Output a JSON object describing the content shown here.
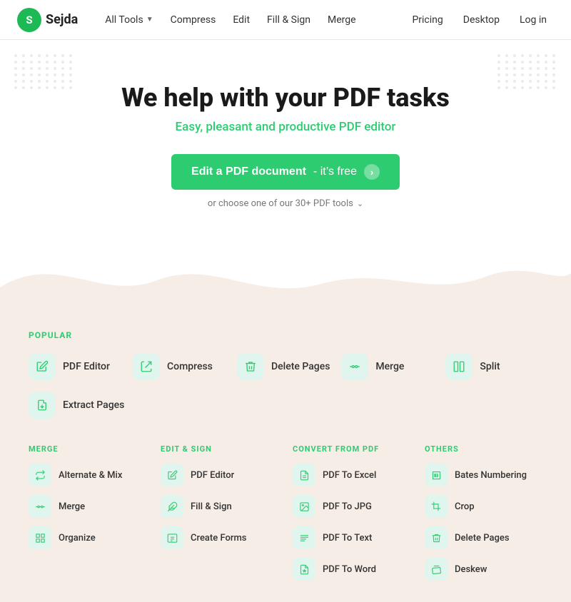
{
  "brand": {
    "logo_letter": "S",
    "name": "Sejda"
  },
  "navbar": {
    "links": [
      {
        "id": "all-tools",
        "label": "All Tools",
        "has_chevron": true
      },
      {
        "id": "compress",
        "label": "Compress",
        "has_chevron": false
      },
      {
        "id": "edit",
        "label": "Edit",
        "has_chevron": false
      },
      {
        "id": "fill-sign",
        "label": "Fill & Sign",
        "has_chevron": false
      },
      {
        "id": "merge",
        "label": "Merge",
        "has_chevron": false
      }
    ],
    "right_links": [
      {
        "id": "pricing",
        "label": "Pricing"
      },
      {
        "id": "desktop",
        "label": "Desktop"
      },
      {
        "id": "login",
        "label": "Log in"
      }
    ]
  },
  "hero": {
    "title_line1": "We help with your PDF tasks",
    "subtitle": "Easy, pleasant and productive PDF editor",
    "cta_label": "Edit a PDF document",
    "cta_suffix": "- it’s free",
    "cta_sub": "or choose one of our 30+ PDF tools"
  },
  "popular": {
    "section_title": "POPULAR",
    "items": [
      {
        "id": "pdf-editor",
        "label": "PDF Editor",
        "icon": "edit"
      },
      {
        "id": "compress",
        "label": "Compress",
        "icon": "compress"
      },
      {
        "id": "delete-pages",
        "label": "Delete Pages",
        "icon": "delete"
      },
      {
        "id": "merge",
        "label": "Merge",
        "icon": "merge"
      },
      {
        "id": "split",
        "label": "Split",
        "icon": "split"
      },
      {
        "id": "extract-pages",
        "label": "Extract Pages",
        "icon": "extract"
      }
    ]
  },
  "categories": [
    {
      "id": "merge",
      "title": "MERGE",
      "items": [
        {
          "label": "Alternate & Mix",
          "icon": "alternate"
        },
        {
          "label": "Merge",
          "icon": "merge"
        },
        {
          "label": "Organize",
          "icon": "organize"
        }
      ]
    },
    {
      "id": "edit-sign",
      "title": "EDIT & SIGN",
      "items": [
        {
          "label": "PDF Editor",
          "icon": "edit"
        },
        {
          "label": "Fill & Sign",
          "icon": "fillsign"
        },
        {
          "label": "Create Forms",
          "icon": "forms"
        }
      ]
    },
    {
      "id": "convert-from-pdf",
      "title": "CONVERT FROM PDF",
      "items": [
        {
          "label": "PDF To Excel",
          "icon": "excel"
        },
        {
          "label": "PDF To JPG",
          "icon": "jpg"
        },
        {
          "label": "PDF To Text",
          "icon": "text"
        },
        {
          "label": "PDF To Word",
          "icon": "word"
        }
      ]
    },
    {
      "id": "others",
      "title": "OTHERS",
      "items": [
        {
          "label": "Bates Numbering",
          "icon": "bates"
        },
        {
          "label": "Crop",
          "icon": "crop"
        },
        {
          "label": "Delete Pages",
          "icon": "delete"
        },
        {
          "label": "Deskew",
          "icon": "deskew"
        }
      ]
    }
  ]
}
